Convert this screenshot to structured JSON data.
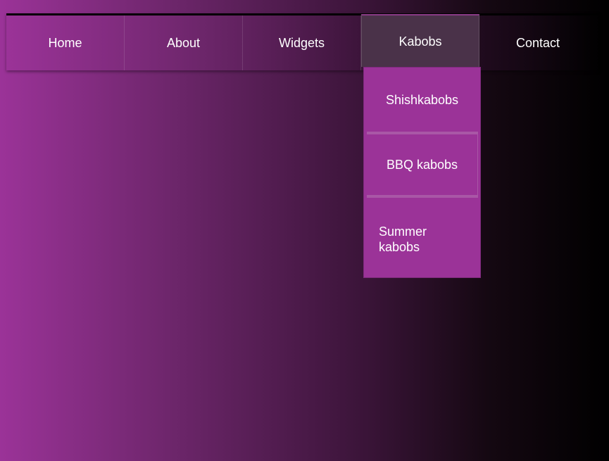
{
  "nav": {
    "items": [
      {
        "label": "Home"
      },
      {
        "label": "About"
      },
      {
        "label": "Widgets"
      },
      {
        "label": "Kabobs"
      },
      {
        "label": "Contact"
      }
    ],
    "active_index": 3
  },
  "dropdown": {
    "items": [
      {
        "label": "Shishkabobs"
      },
      {
        "label": "BBQ kabobs"
      },
      {
        "label": "Summer kabobs"
      }
    ]
  },
  "colors": {
    "accent": "#9b3398",
    "active_tab": "#4a3249",
    "text": "#ffffff"
  }
}
